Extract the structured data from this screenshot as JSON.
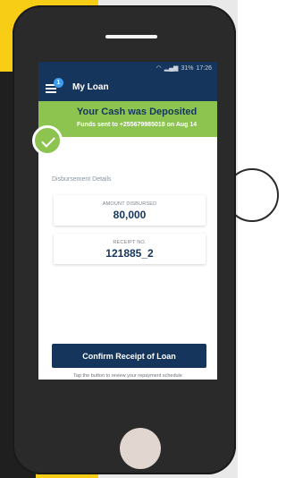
{
  "status": {
    "time": "17:26",
    "battery": "31%"
  },
  "appbar": {
    "title": "My Loan",
    "badge": "1"
  },
  "banner": {
    "title": "Your Cash was Deposited",
    "subtitle": "Funds sent to +255679985018 on Aug 14"
  },
  "details": {
    "section_label": "Disbursement Details",
    "amount_label": "AMOUNT DISBURSED",
    "amount_value": "80,000",
    "receipt_label": "RECEIPT NO.",
    "receipt_value": "121885_2"
  },
  "actions": {
    "confirm_label": "Confirm Receipt of Loan",
    "hint": "Tap the button to review your repayment schedule"
  },
  "colors": {
    "navy": "#15355c",
    "green": "#8cc44f",
    "yellow": "#f7cd16"
  },
  "icons": {
    "menu": "hamburger-menu-icon",
    "success": "check-icon"
  }
}
